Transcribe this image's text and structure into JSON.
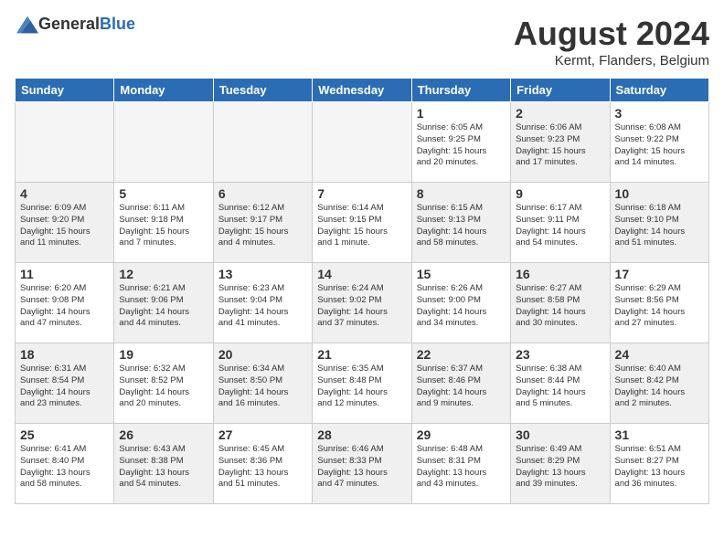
{
  "header": {
    "logo_general": "General",
    "logo_blue": "Blue",
    "month": "August 2024",
    "location": "Kermt, Flanders, Belgium"
  },
  "weekdays": [
    "Sunday",
    "Monday",
    "Tuesday",
    "Wednesday",
    "Thursday",
    "Friday",
    "Saturday"
  ],
  "weeks": [
    [
      {
        "day": "",
        "info": "",
        "empty": true
      },
      {
        "day": "",
        "info": "",
        "empty": true
      },
      {
        "day": "",
        "info": "",
        "empty": true
      },
      {
        "day": "",
        "info": "",
        "empty": true
      },
      {
        "day": "1",
        "info": "Sunrise: 6:05 AM\nSunset: 9:25 PM\nDaylight: 15 hours\nand 20 minutes.",
        "shaded": false
      },
      {
        "day": "2",
        "info": "Sunrise: 6:06 AM\nSunset: 9:23 PM\nDaylight: 15 hours\nand 17 minutes.",
        "shaded": true
      },
      {
        "day": "3",
        "info": "Sunrise: 6:08 AM\nSunset: 9:22 PM\nDaylight: 15 hours\nand 14 minutes.",
        "shaded": false
      }
    ],
    [
      {
        "day": "4",
        "info": "Sunrise: 6:09 AM\nSunset: 9:20 PM\nDaylight: 15 hours\nand 11 minutes.",
        "shaded": true
      },
      {
        "day": "5",
        "info": "Sunrise: 6:11 AM\nSunset: 9:18 PM\nDaylight: 15 hours\nand 7 minutes.",
        "shaded": false
      },
      {
        "day": "6",
        "info": "Sunrise: 6:12 AM\nSunset: 9:17 PM\nDaylight: 15 hours\nand 4 minutes.",
        "shaded": true
      },
      {
        "day": "7",
        "info": "Sunrise: 6:14 AM\nSunset: 9:15 PM\nDaylight: 15 hours\nand 1 minute.",
        "shaded": false
      },
      {
        "day": "8",
        "info": "Sunrise: 6:15 AM\nSunset: 9:13 PM\nDaylight: 14 hours\nand 58 minutes.",
        "shaded": true
      },
      {
        "day": "9",
        "info": "Sunrise: 6:17 AM\nSunset: 9:11 PM\nDaylight: 14 hours\nand 54 minutes.",
        "shaded": false
      },
      {
        "day": "10",
        "info": "Sunrise: 6:18 AM\nSunset: 9:10 PM\nDaylight: 14 hours\nand 51 minutes.",
        "shaded": true
      }
    ],
    [
      {
        "day": "11",
        "info": "Sunrise: 6:20 AM\nSunset: 9:08 PM\nDaylight: 14 hours\nand 47 minutes.",
        "shaded": false
      },
      {
        "day": "12",
        "info": "Sunrise: 6:21 AM\nSunset: 9:06 PM\nDaylight: 14 hours\nand 44 minutes.",
        "shaded": true
      },
      {
        "day": "13",
        "info": "Sunrise: 6:23 AM\nSunset: 9:04 PM\nDaylight: 14 hours\nand 41 minutes.",
        "shaded": false
      },
      {
        "day": "14",
        "info": "Sunrise: 6:24 AM\nSunset: 9:02 PM\nDaylight: 14 hours\nand 37 minutes.",
        "shaded": true
      },
      {
        "day": "15",
        "info": "Sunrise: 6:26 AM\nSunset: 9:00 PM\nDaylight: 14 hours\nand 34 minutes.",
        "shaded": false
      },
      {
        "day": "16",
        "info": "Sunrise: 6:27 AM\nSunset: 8:58 PM\nDaylight: 14 hours\nand 30 minutes.",
        "shaded": true
      },
      {
        "day": "17",
        "info": "Sunrise: 6:29 AM\nSunset: 8:56 PM\nDaylight: 14 hours\nand 27 minutes.",
        "shaded": false
      }
    ],
    [
      {
        "day": "18",
        "info": "Sunrise: 6:31 AM\nSunset: 8:54 PM\nDaylight: 14 hours\nand 23 minutes.",
        "shaded": true
      },
      {
        "day": "19",
        "info": "Sunrise: 6:32 AM\nSunset: 8:52 PM\nDaylight: 14 hours\nand 20 minutes.",
        "shaded": false
      },
      {
        "day": "20",
        "info": "Sunrise: 6:34 AM\nSunset: 8:50 PM\nDaylight: 14 hours\nand 16 minutes.",
        "shaded": true
      },
      {
        "day": "21",
        "info": "Sunrise: 6:35 AM\nSunset: 8:48 PM\nDaylight: 14 hours\nand 12 minutes.",
        "shaded": false
      },
      {
        "day": "22",
        "info": "Sunrise: 6:37 AM\nSunset: 8:46 PM\nDaylight: 14 hours\nand 9 minutes.",
        "shaded": true
      },
      {
        "day": "23",
        "info": "Sunrise: 6:38 AM\nSunset: 8:44 PM\nDaylight: 14 hours\nand 5 minutes.",
        "shaded": false
      },
      {
        "day": "24",
        "info": "Sunrise: 6:40 AM\nSunset: 8:42 PM\nDaylight: 14 hours\nand 2 minutes.",
        "shaded": true
      }
    ],
    [
      {
        "day": "25",
        "info": "Sunrise: 6:41 AM\nSunset: 8:40 PM\nDaylight: 13 hours\nand 58 minutes.",
        "shaded": false
      },
      {
        "day": "26",
        "info": "Sunrise: 6:43 AM\nSunset: 8:38 PM\nDaylight: 13 hours\nand 54 minutes.",
        "shaded": true
      },
      {
        "day": "27",
        "info": "Sunrise: 6:45 AM\nSunset: 8:36 PM\nDaylight: 13 hours\nand 51 minutes.",
        "shaded": false
      },
      {
        "day": "28",
        "info": "Sunrise: 6:46 AM\nSunset: 8:33 PM\nDaylight: 13 hours\nand 47 minutes.",
        "shaded": true
      },
      {
        "day": "29",
        "info": "Sunrise: 6:48 AM\nSunset: 8:31 PM\nDaylight: 13 hours\nand 43 minutes.",
        "shaded": false
      },
      {
        "day": "30",
        "info": "Sunrise: 6:49 AM\nSunset: 8:29 PM\nDaylight: 13 hours\nand 39 minutes.",
        "shaded": true
      },
      {
        "day": "31",
        "info": "Sunrise: 6:51 AM\nSunset: 8:27 PM\nDaylight: 13 hours\nand 36 minutes.",
        "shaded": false
      }
    ]
  ]
}
